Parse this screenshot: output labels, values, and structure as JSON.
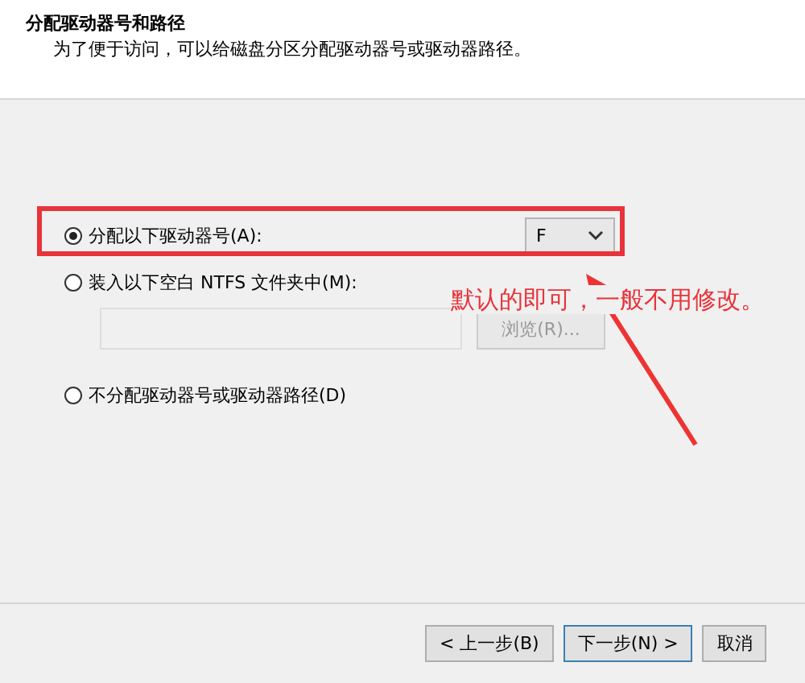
{
  "header": {
    "title": "分配驱动器号和路径",
    "description": "为了便于访问，可以给磁盘分区分配驱动器号或驱动器路径。"
  },
  "options": [
    {
      "kind": "letter",
      "label": "分配以下驱动器号(A):",
      "selected": true,
      "value": "F"
    },
    {
      "kind": "folder",
      "label": "装入以下空白 NTFS 文件夹中(M):",
      "selected": false,
      "button": "浏览(R)...",
      "disabled": true
    },
    {
      "kind": "none",
      "label": "不分配驱动器号或驱动器路径(D)",
      "selected": false
    }
  ],
  "annotation": {
    "text": "默认的即可，一般不用修改。"
  },
  "buttons": [
    "< 上一步(B)",
    "下一步(N) >",
    "取消"
  ]
}
